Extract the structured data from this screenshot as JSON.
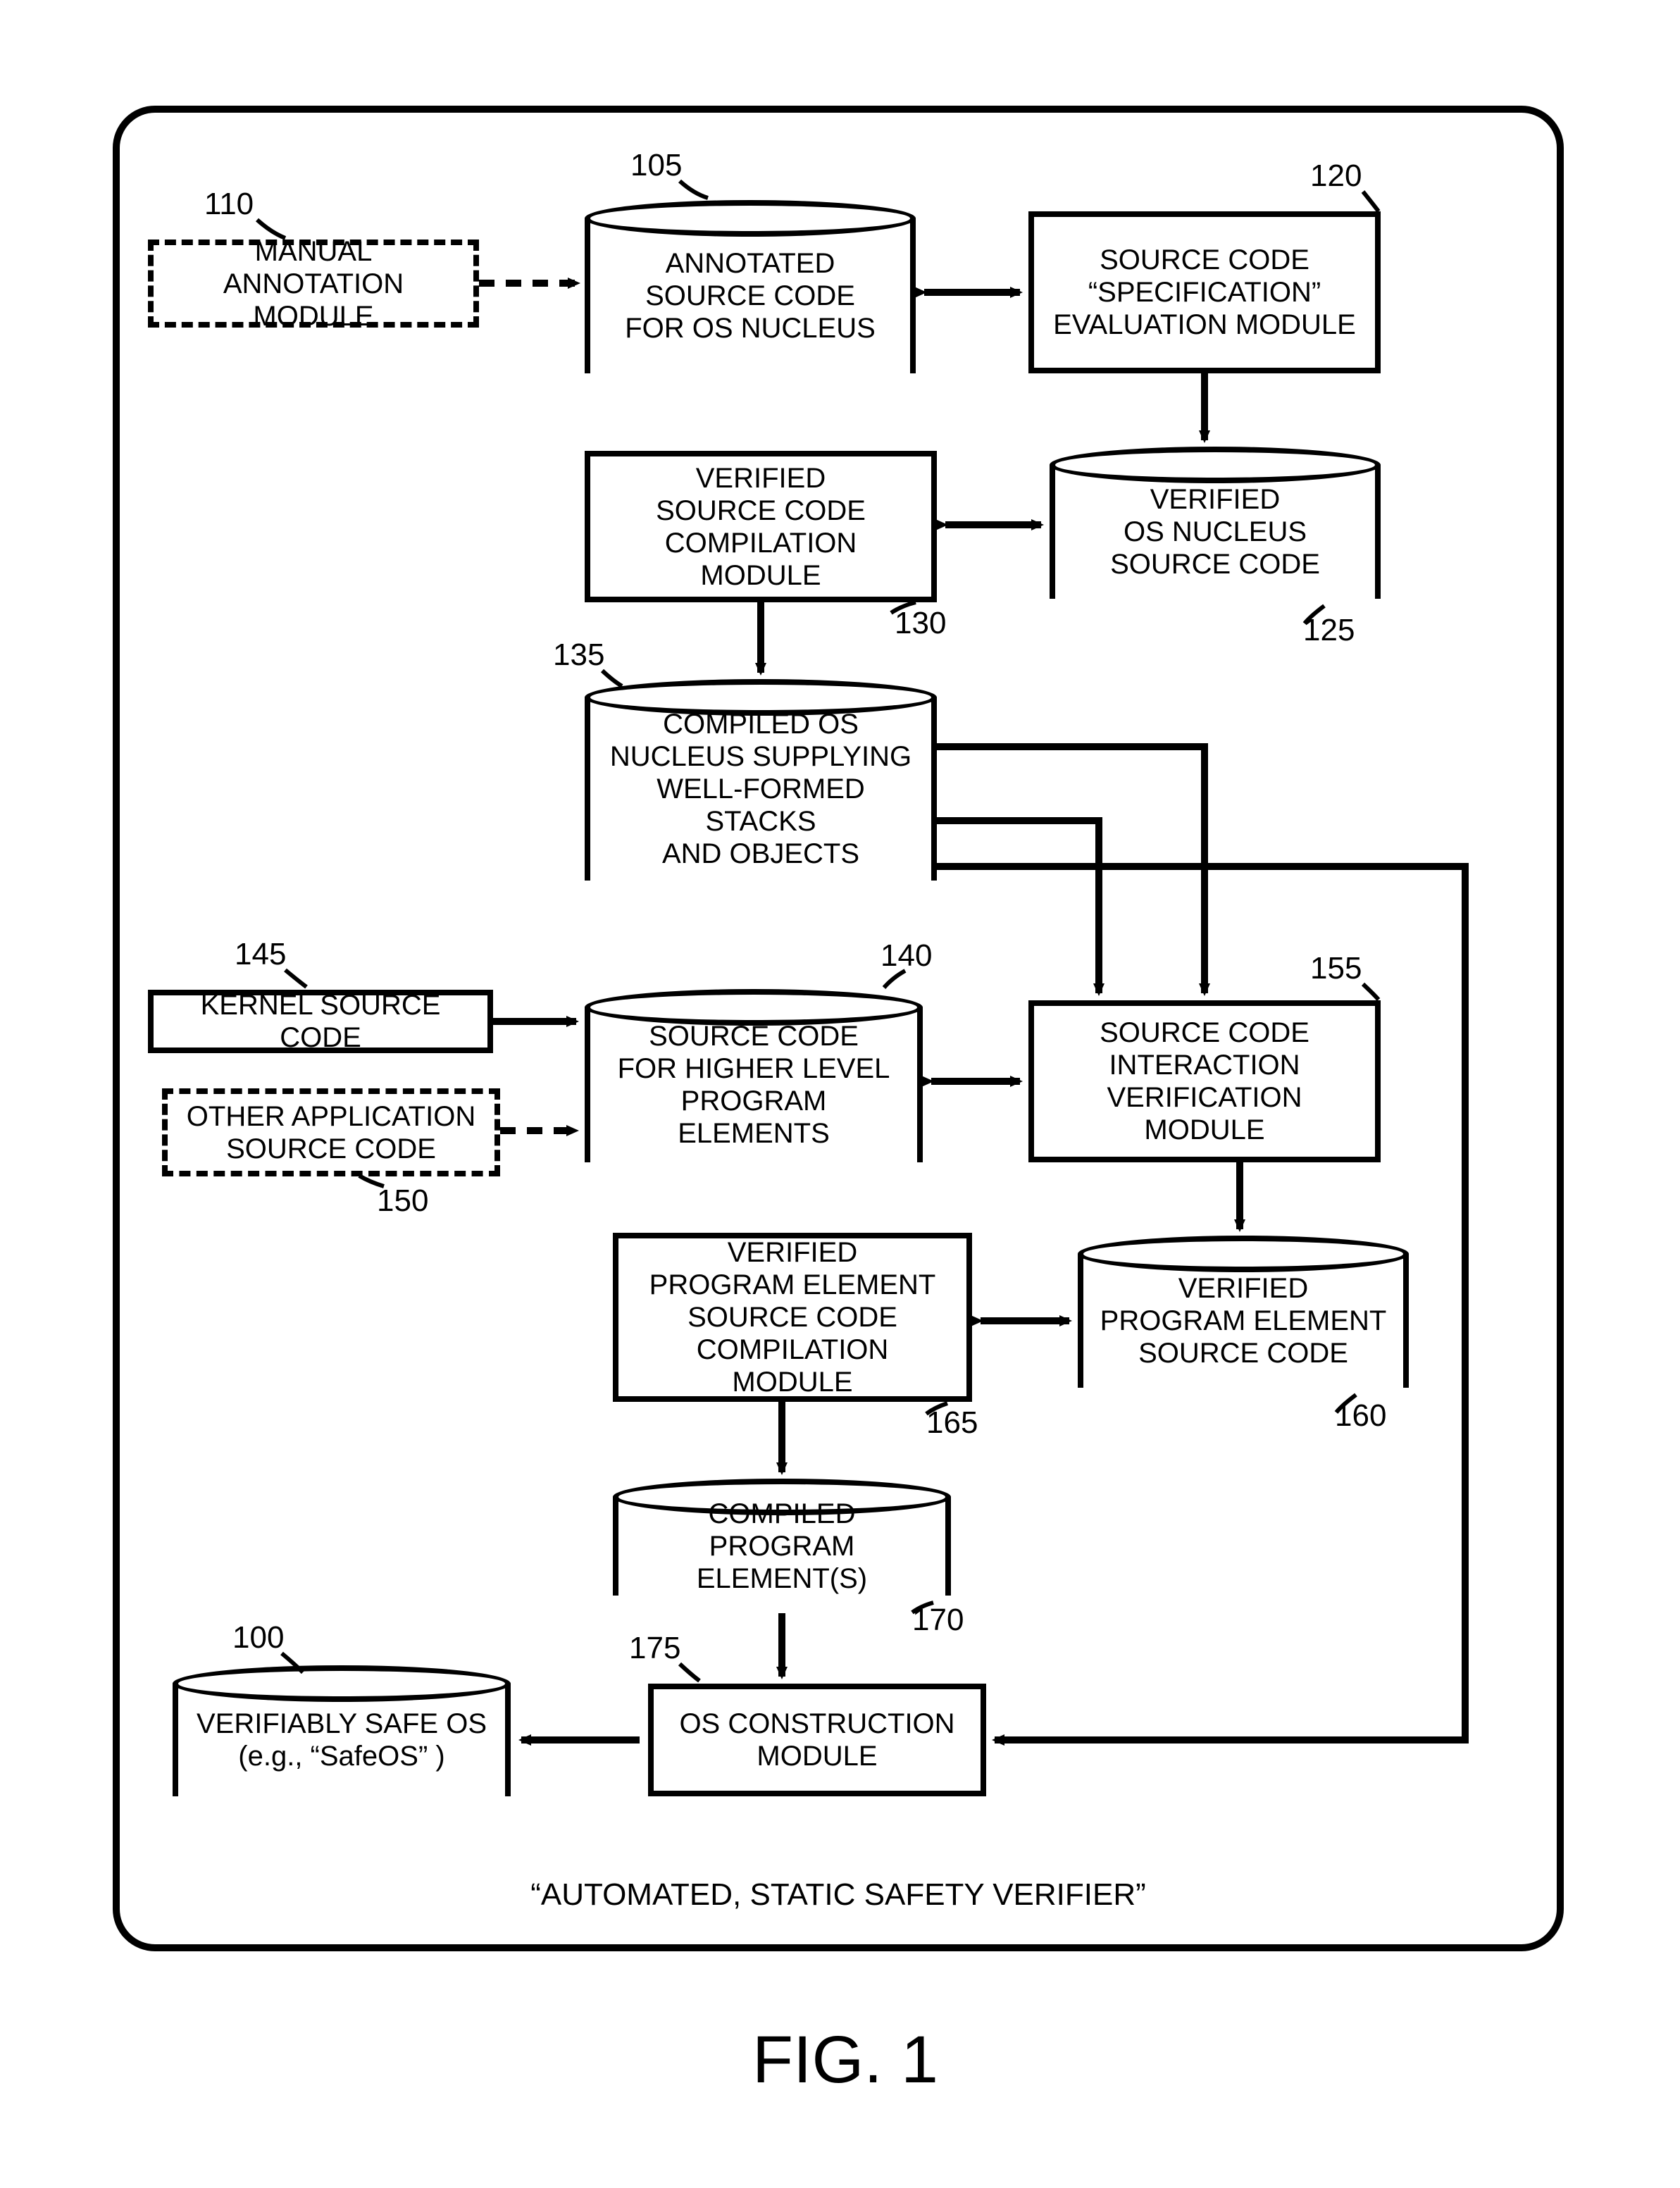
{
  "title": "“AUTOMATED, STATIC SAFETY VERIFIER”",
  "figure": "FIG. 1",
  "refs": {
    "r100": "100",
    "r105": "105",
    "r110": "110",
    "r120": "120",
    "r125": "125",
    "r130": "130",
    "r135": "135",
    "r140": "140",
    "r145": "145",
    "r150": "150",
    "r155": "155",
    "r160": "160",
    "r165": "165",
    "r170": "170",
    "r175": "175"
  },
  "nodes": {
    "n110": "MANUAL\nANNOTATION MODULE",
    "n105": "ANNOTATED\nSOURCE CODE\nFOR OS NUCLEUS",
    "n120": "SOURCE CODE\n“SPECIFICATION”\nEVALUATION MODULE",
    "n130": "VERIFIED\nSOURCE CODE\nCOMPILATION MODULE",
    "n125": "VERIFIED\nOS NUCLEUS\nSOURCE CODE",
    "n135": "COMPILED OS\nNUCLEUS SUPPLYING\nWELL-FORMED STACKS\nAND OBJECTS",
    "n145": "KERNEL SOURCE CODE",
    "n150": "OTHER APPLICATION\nSOURCE CODE",
    "n140": "SOURCE CODE\nFOR HIGHER LEVEL\nPROGRAM ELEMENTS",
    "n155": "SOURCE CODE\nINTERACTION\nVERIFICATION MODULE",
    "n165": "VERIFIED\nPROGRAM ELEMENT\nSOURCE CODE\nCOMPILATION MODULE",
    "n160": "VERIFIED\nPROGRAM ELEMENT\nSOURCE CODE",
    "n170": "COMPILED PROGRAM\nELEMENT(S)",
    "n175": "OS CONSTRUCTION\nMODULE",
    "n100": "VERIFIABLY SAFE OS\n(e.g., “SafeOS” )"
  },
  "chart_data": {
    "type": "flowchart",
    "nodes": [
      {
        "id": "110",
        "label": "MANUAL ANNOTATION MODULE",
        "shape": "dashed-rect"
      },
      {
        "id": "105",
        "label": "ANNOTATED SOURCE CODE FOR OS NUCLEUS",
        "shape": "cylinder"
      },
      {
        "id": "120",
        "label": "SOURCE CODE “SPECIFICATION” EVALUATION MODULE",
        "shape": "rect"
      },
      {
        "id": "130",
        "label": "VERIFIED SOURCE CODE COMPILATION MODULE",
        "shape": "rect"
      },
      {
        "id": "125",
        "label": "VERIFIED OS NUCLEUS SOURCE CODE",
        "shape": "cylinder"
      },
      {
        "id": "135",
        "label": "COMPILED OS NUCLEUS SUPPLYING WELL-FORMED STACKS AND OBJECTS",
        "shape": "cylinder"
      },
      {
        "id": "145",
        "label": "KERNEL SOURCE CODE",
        "shape": "rect"
      },
      {
        "id": "150",
        "label": "OTHER APPLICATION SOURCE CODE",
        "shape": "dashed-rect"
      },
      {
        "id": "140",
        "label": "SOURCE CODE FOR HIGHER LEVEL PROGRAM ELEMENTS",
        "shape": "cylinder"
      },
      {
        "id": "155",
        "label": "SOURCE CODE INTERACTION VERIFICATION MODULE",
        "shape": "rect"
      },
      {
        "id": "165",
        "label": "VERIFIED PROGRAM ELEMENT SOURCE CODE COMPILATION MODULE",
        "shape": "rect"
      },
      {
        "id": "160",
        "label": "VERIFIED PROGRAM ELEMENT SOURCE CODE",
        "shape": "cylinder"
      },
      {
        "id": "170",
        "label": "COMPILED PROGRAM ELEMENT(S)",
        "shape": "cylinder"
      },
      {
        "id": "175",
        "label": "OS CONSTRUCTION MODULE",
        "shape": "rect"
      },
      {
        "id": "100",
        "label": "VERIFIABLY SAFE OS (e.g., “SafeOS”)",
        "shape": "cylinder"
      }
    ],
    "edges": [
      {
        "from": "110",
        "to": "105",
        "style": "dashed",
        "bidir": false
      },
      {
        "from": "105",
        "to": "120",
        "bidir": true
      },
      {
        "from": "120",
        "to": "125",
        "bidir": false
      },
      {
        "from": "125",
        "to": "130",
        "bidir": true
      },
      {
        "from": "130",
        "to": "135",
        "bidir": false
      },
      {
        "from": "145",
        "to": "140",
        "bidir": false
      },
      {
        "from": "150",
        "to": "140",
        "style": "dashed",
        "bidir": false
      },
      {
        "from": "140",
        "to": "155",
        "bidir": true
      },
      {
        "from": "135",
        "to": "155",
        "bidir": false
      },
      {
        "from": "155",
        "to": "160",
        "bidir": false
      },
      {
        "from": "160",
        "to": "165",
        "bidir": true
      },
      {
        "from": "165",
        "to": "170",
        "bidir": false
      },
      {
        "from": "170",
        "to": "175",
        "bidir": false
      },
      {
        "from": "135",
        "to": "175",
        "bidir": false
      },
      {
        "from": "175",
        "to": "100",
        "bidir": false
      }
    ],
    "container_label": "AUTOMATED, STATIC SAFETY VERIFIER"
  }
}
